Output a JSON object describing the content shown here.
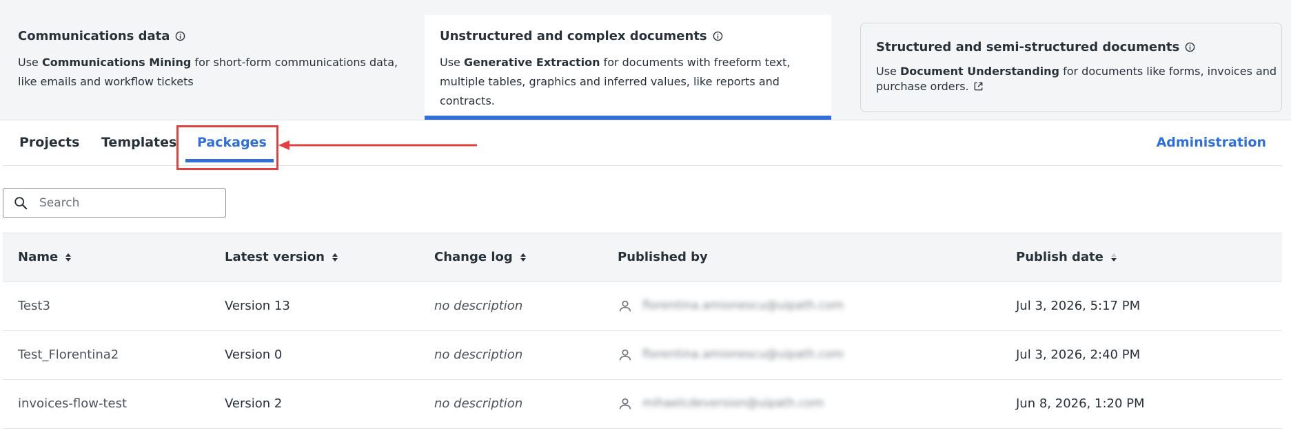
{
  "cards": [
    {
      "title": "Communications data",
      "desc_prefix": "Use ",
      "desc_bold": "Communications Mining",
      "desc_suffix": " for short-form communications data, like emails and workflow tickets"
    },
    {
      "title": "Unstructured and complex documents",
      "desc_prefix": "Use ",
      "desc_bold": "Generative Extraction",
      "desc_suffix": " for documents with freeform text, multiple tables, graphics and inferred values, like reports and contracts."
    },
    {
      "title": "Structured and semi-structured documents",
      "desc_prefix": "Use ",
      "desc_bold": "Document Understanding",
      "desc_suffix": " for documents like forms, invoices and purchase orders."
    }
  ],
  "tabs": {
    "projects": "Projects",
    "templates": "Templates",
    "packages": "Packages",
    "active": "Packages"
  },
  "administration": "Administration",
  "search": {
    "placeholder": "Search"
  },
  "table": {
    "columns": {
      "name": "Name",
      "latest_version": "Latest version",
      "change_log": "Change log",
      "published_by": "Published by",
      "publish_date": "Publish date"
    },
    "rows": [
      {
        "name": "Test3",
        "version": "Version 13",
        "change_log": "no description",
        "published_by": "florentina.amionescu@uipath.com",
        "date": "Jul 3, 2026, 5:17 PM"
      },
      {
        "name": "Test_Florentina2",
        "version": "Version 0",
        "change_log": "no description",
        "published_by": "florentina.amionescu@uipath.com",
        "date": "Jul 3, 2026, 2:40 PM"
      },
      {
        "name": "invoices-flow-test",
        "version": "Version 2",
        "change_log": "no description",
        "published_by": "mihaelcdeversion@uipath.com",
        "date": "Jun 8, 2026, 1:20 PM"
      }
    ]
  },
  "colors": {
    "accent": "#2f6fd7",
    "highlight": "#e0403f",
    "text": "#273139",
    "header_bg": "#f4f5f7"
  }
}
